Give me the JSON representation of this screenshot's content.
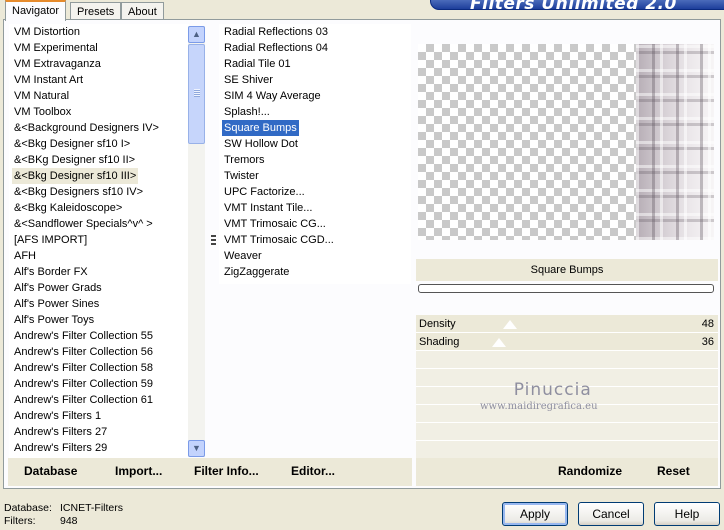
{
  "tabs": [
    "Navigator",
    "Presets",
    "About"
  ],
  "banner_title": "Filters Unlimited 2.0",
  "categories": [
    "VM Distortion",
    "VM Experimental",
    "VM Extravaganza",
    "VM Instant Art",
    "VM Natural",
    "VM Toolbox",
    "&<Background Designers IV>",
    "&<Bkg Designer sf10 I>",
    "&<BKg Designer sf10 II>",
    "&<Bkg Designer sf10 III>",
    "&<Bkg Designers sf10 IV>",
    "&<Bkg Kaleidoscope>",
    "&<Sandflower Specials^v^ >",
    "[AFS IMPORT]",
    "AFH",
    "Alf's Border FX",
    "Alf's Power Grads",
    "Alf's Power Sines",
    "Alf's Power Toys",
    "Andrew's Filter Collection 55",
    "Andrew's Filter Collection 56",
    "Andrew's Filter Collection 58",
    "Andrew's Filter Collection 59",
    "Andrew's Filter Collection 61",
    "Andrew's Filters 1",
    "Andrew's Filters 27",
    "Andrew's Filters 29"
  ],
  "selected_category": "&<Bkg Designer sf10 III>",
  "filters": [
    "Radial Reflections 03",
    "Radial Reflections 04",
    "Radial Tile 01",
    "SE Shiver",
    "SIM 4 Way Average",
    "Splash!...",
    "Square Bumps",
    "SW Hollow Dot",
    "Tremors",
    "Twister",
    "UPC Factorize...",
    "VMT Instant Tile...",
    "VMT Trimosaic CG...",
    "VMT Trimosaic CGD...",
    "Weaver",
    "ZigZaggerate"
  ],
  "selected_filter": "Square Bumps",
  "marked_filter": "VMT Trimosaic CGD...",
  "filter_name": "Square Bumps",
  "params": [
    {
      "label": "Density",
      "value": "48",
      "level": 0.19
    },
    {
      "label": "Shading",
      "value": "36",
      "level": 0.14
    }
  ],
  "watermark": {
    "name": "Pinuccia",
    "url": "www.maidiregrafica.eu"
  },
  "links": {
    "database": "Database",
    "import": "Import...",
    "filter_info": "Filter Info...",
    "editor": "Editor...",
    "randomize": "Randomize",
    "reset": "Reset"
  },
  "status": {
    "database_label": "Database:",
    "database_value": "ICNET-Filters",
    "filters_label": "Filters:",
    "filters_value": "948"
  },
  "buttons": {
    "apply": "Apply",
    "cancel": "Cancel",
    "help": "Help"
  },
  "colors": {
    "selection": "#316ac5",
    "banner": "#1d3f9b",
    "tab_accent": "#e68b2c"
  }
}
